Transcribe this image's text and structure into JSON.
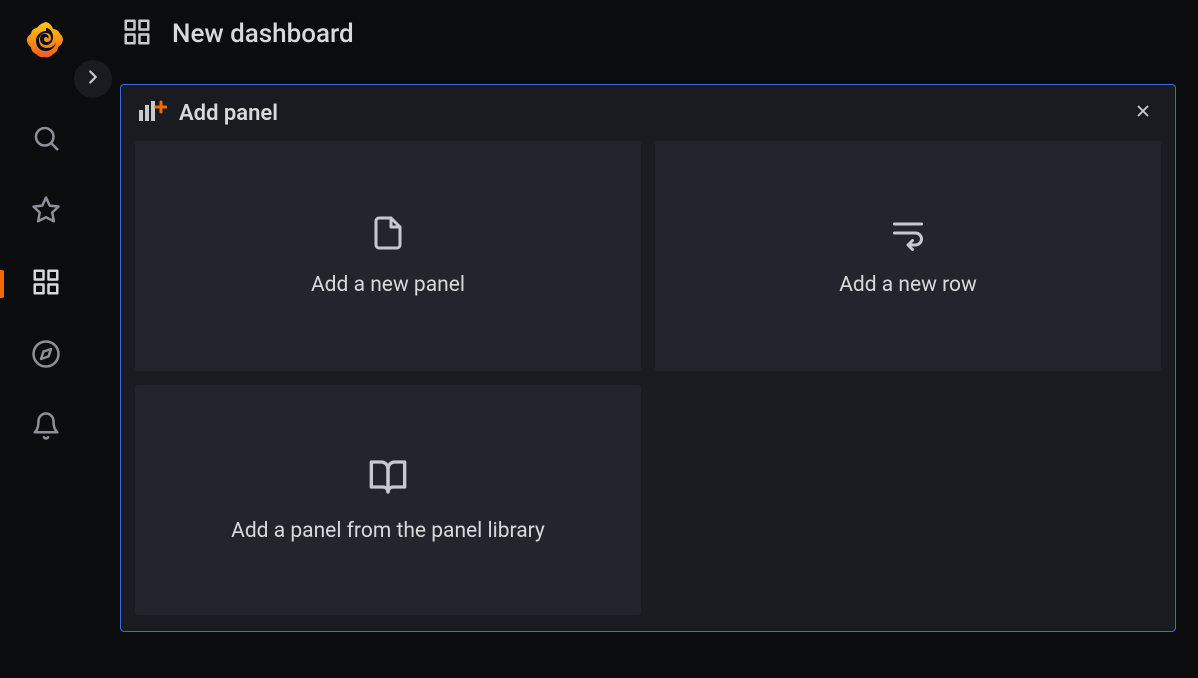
{
  "topbar": {
    "title": "New dashboard"
  },
  "sidebar": {
    "items": [
      {
        "name": "search"
      },
      {
        "name": "favorite"
      },
      {
        "name": "dashboards",
        "active": true
      },
      {
        "name": "explore"
      },
      {
        "name": "alerts"
      }
    ]
  },
  "addPanel": {
    "title": "Add panel",
    "options": [
      {
        "label": "Add a new panel",
        "icon": "file-icon"
      },
      {
        "label": "Add a new row",
        "icon": "wrap-text-icon"
      },
      {
        "label": "Add a panel from the panel library",
        "icon": "book-open-icon"
      }
    ]
  }
}
